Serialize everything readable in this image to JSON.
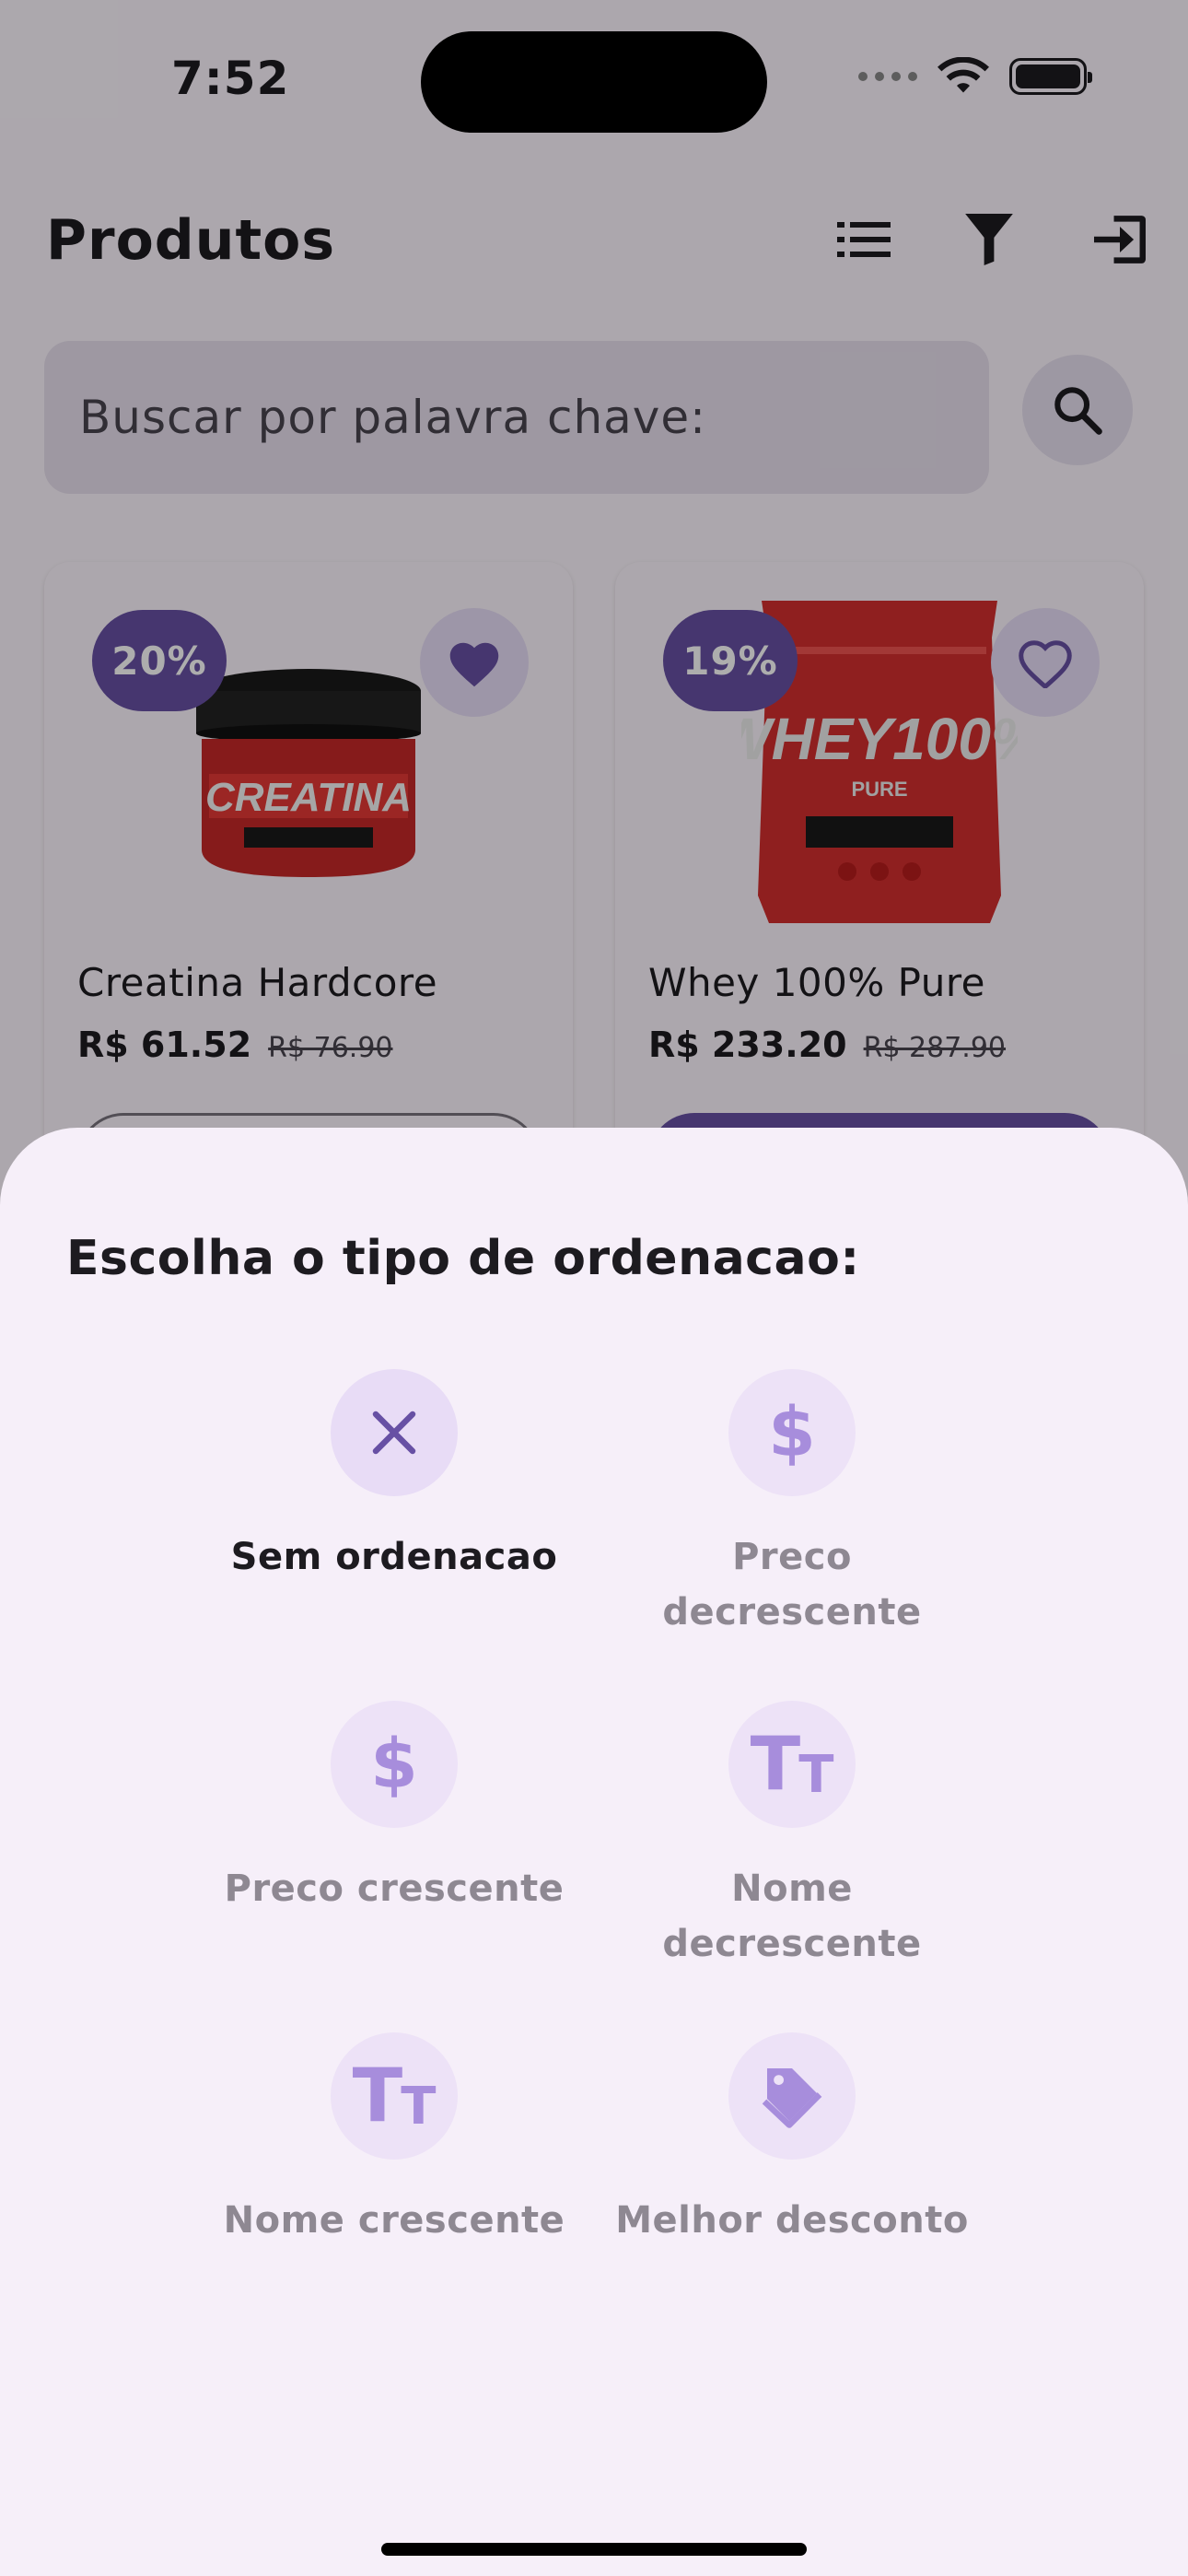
{
  "status_bar": {
    "time": "7:52"
  },
  "app_bar": {
    "title": "Produtos",
    "icons": [
      "list-icon",
      "filter-icon",
      "logout-icon"
    ]
  },
  "search": {
    "placeholder": "Buscar por palavra chave:"
  },
  "products": [
    {
      "name": "Creatina Hardcore",
      "price": "R$ 61.52",
      "old_price": "R$ 76.90",
      "discount": "20%",
      "favorite": true
    },
    {
      "name": "Whey 100% Pure",
      "price": "R$ 233.20",
      "old_price": "R$ 287.90",
      "discount": "19%",
      "favorite": false
    }
  ],
  "sort_sheet": {
    "title": "Escolha o tipo de ordenacao:",
    "options": [
      {
        "label": "Sem ordenacao",
        "icon": "close-icon",
        "selected": true
      },
      {
        "label": "Preco decrescente",
        "icon": "dollar-icon",
        "selected": false
      },
      {
        "label": "Preco crescente",
        "icon": "dollar-icon",
        "selected": false
      },
      {
        "label": "Nome decrescente",
        "icon": "text-size-icon",
        "selected": false
      },
      {
        "label": "Nome crescente",
        "icon": "text-size-icon",
        "selected": false
      },
      {
        "label": "Melhor desconto",
        "icon": "tag-icon",
        "selected": false
      }
    ]
  },
  "colors": {
    "primary": "#6750a4",
    "sheet": "#f6eff9",
    "icon_tint": "#a78ddc"
  }
}
